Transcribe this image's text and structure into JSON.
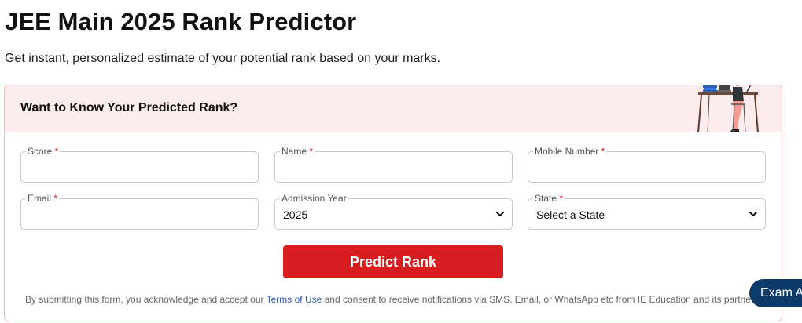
{
  "page": {
    "title": "JEE Main 2025 Rank Predictor",
    "subtitle": "Get instant, personalized estimate of your potential rank based on your marks."
  },
  "form": {
    "header_title": "Want to Know Your Predicted Rank?",
    "fields": {
      "score": {
        "label": "Score",
        "value": ""
      },
      "name": {
        "label": "Name",
        "value": ""
      },
      "mobile": {
        "label": "Mobile Number",
        "value": ""
      },
      "email": {
        "label": "Email",
        "value": ""
      },
      "admission_year": {
        "label": "Admission Year",
        "value": "2025"
      },
      "state": {
        "label": "State",
        "value": "Select a State"
      }
    },
    "required_marker": "*",
    "submit_label": "Predict Rank",
    "disclaimer": {
      "prefix": "By submitting this form, you acknowledge and accept our ",
      "link_text": "Terms of Use",
      "suffix": " and consent to receive notifications via SMS, Email, or WhatsApp etc from IE Education and its partne"
    }
  },
  "floating": {
    "exam_alert_label": "Exam A"
  },
  "icons": {
    "illustration": "student-studying-at-desk-illustration",
    "dropdown": "chevron-down-icon"
  },
  "colors": {
    "brand_red": "#d71d20",
    "header_bg": "#fdeced",
    "required_red": "#d42020",
    "link_blue": "#2a58b5",
    "alert_navy": "#0b3a6b"
  }
}
